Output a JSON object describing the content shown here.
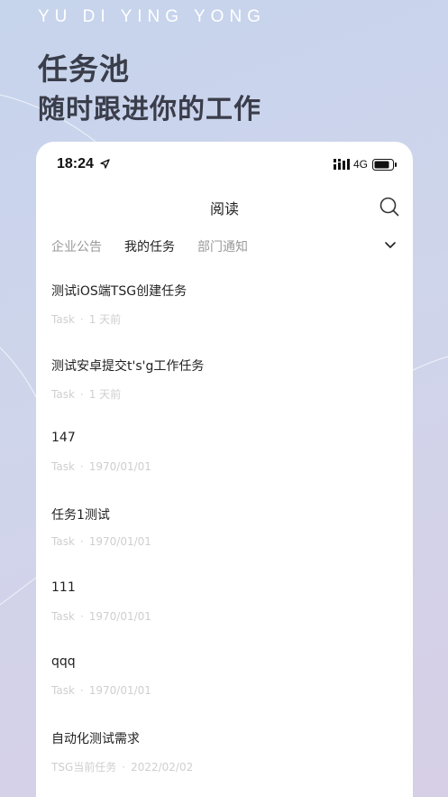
{
  "header": {
    "brand": "YU DI YING YONG",
    "headline_line1": "任务池",
    "headline_line2": "随时跟进你的工作"
  },
  "status_bar": {
    "time": "18:24",
    "network": "4G"
  },
  "nav": {
    "title": "阅读"
  },
  "tabs": [
    {
      "label": "企业公告",
      "active": false
    },
    {
      "label": "我的任务",
      "active": true
    },
    {
      "label": "部门通知",
      "active": false
    }
  ],
  "tasks": [
    {
      "title": "测试iOS端TSG创建任务",
      "type": "Task",
      "time": "1 天前"
    },
    {
      "title": "测试安卓提交t's'g工作任务",
      "type": "Task",
      "time": "1 天前"
    },
    {
      "title": "147",
      "type": "Task",
      "time": "1970/01/01"
    },
    {
      "title": "任务1测试",
      "type": "Task",
      "time": "1970/01/01"
    },
    {
      "title": "111",
      "type": "Task",
      "time": "1970/01/01"
    },
    {
      "title": "qqq",
      "type": "Task",
      "time": "1970/01/01"
    },
    {
      "title": "自动化测试需求",
      "type": "TSG当前任务",
      "time": "2022/02/02"
    }
  ]
}
